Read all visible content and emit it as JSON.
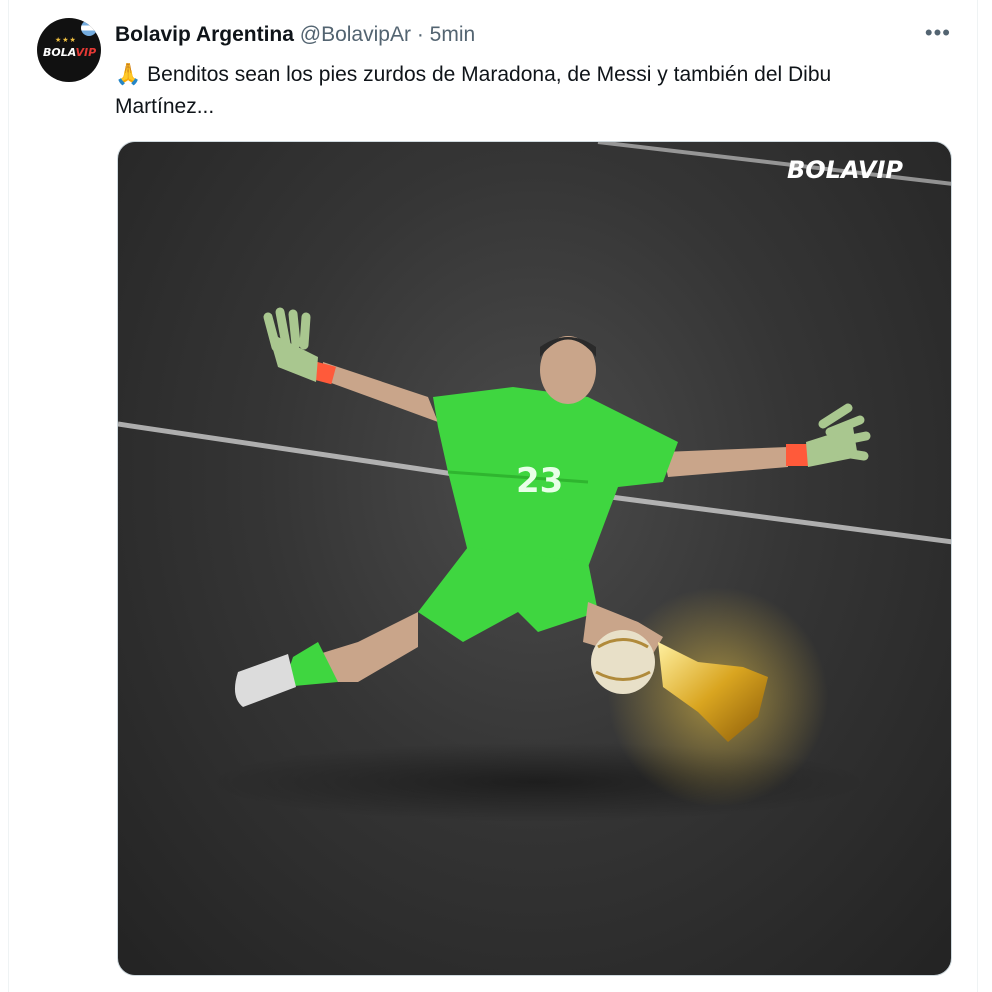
{
  "account": {
    "display_name": "Bolavip Argentina",
    "handle": "@BolavipAr",
    "separator": "·",
    "time": "5min"
  },
  "avatar": {
    "badge_white": "BOLA",
    "badge_red": "VIP"
  },
  "tweet": {
    "emoji": "🙏",
    "text": "Benditos sean los pies zurdos de Maradona, de Messi y también del Dibu Martínez..."
  },
  "more_menu": {
    "icon": "more-horizontal-icon",
    "glyph": "•••"
  },
  "media": {
    "watermark": "BOLAVIP",
    "jersey_number": "23"
  },
  "colors": {
    "jersey": "#3fd640",
    "gold": "#d9a520",
    "pitch": "#2b2b2b"
  }
}
